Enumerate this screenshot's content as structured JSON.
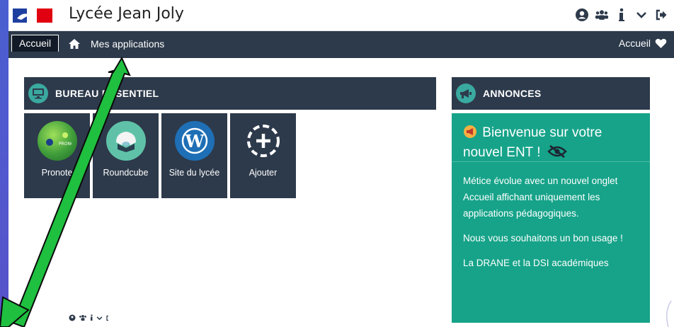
{
  "header": {
    "site_title": "Lycée Jean Joly",
    "icons": [
      "user-circle-icon",
      "users-group-icon",
      "info-icon",
      "chevron-down-icon",
      "logout-icon"
    ]
  },
  "navbar": {
    "tab_accueil": "Accueil",
    "mes_applications": "Mes applications",
    "right_label": "Accueil"
  },
  "bureau": {
    "title": "BUREAU ESSENTIEL",
    "tiles": [
      {
        "label": "Pronote",
        "icon": "pronote-icon"
      },
      {
        "label": "Roundcube",
        "icon": "roundcube-icon"
      },
      {
        "label": "Site du lycée",
        "icon": "wordpress-icon"
      },
      {
        "label": "Ajouter",
        "icon": "add-circle-icon"
      }
    ]
  },
  "annonces": {
    "title": "ANNONCES",
    "card_title": "Bienvenue sur votre nouvel ENT !",
    "paragraphs": [
      "Métice évolue avec un nouvel onglet Accueil affichant uniquement les applications pédagogiques.",
      "Nous vous souhaitons un bon usage !",
      "La DRANE et la DSI académiques"
    ]
  },
  "colors": {
    "navbar": "#2d3a4b",
    "annonce_card": "#16a389",
    "arrow": "#1fbf3f",
    "background": "#5b4fc9"
  }
}
